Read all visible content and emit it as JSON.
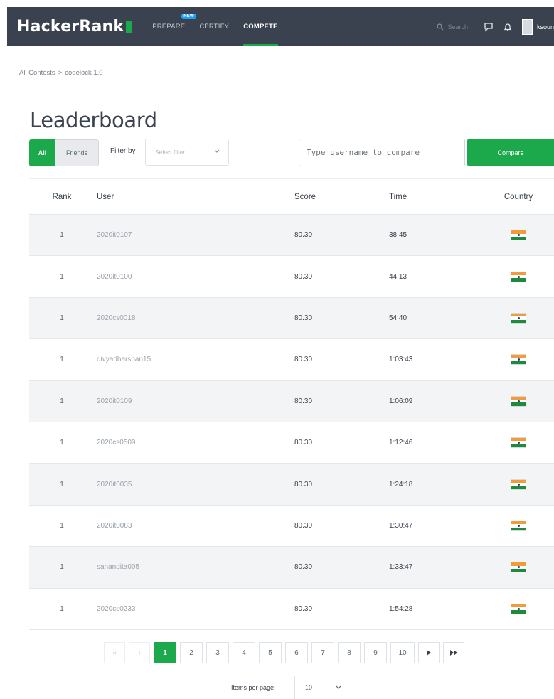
{
  "navbar": {
    "logo": "HackerRank",
    "links": [
      {
        "label": "PREPARE",
        "badge": "NEW"
      },
      {
        "label": "CERTIFY"
      },
      {
        "label": "COMPETE"
      }
    ],
    "search_label": "Search",
    "username": "ksoun_j"
  },
  "breadcrumb": [
    "All Contests",
    ">",
    "codelock 1.0"
  ],
  "page_title": "Leaderboard",
  "toggle": {
    "all": "All",
    "friends": "Friends"
  },
  "filter": {
    "label": "Filter by",
    "placeholder": "Select filter"
  },
  "compare": {
    "placeholder": "Type username to compare",
    "button": "Compare"
  },
  "table": {
    "headers": {
      "rank": "Rank",
      "user": "User",
      "score": "Score",
      "time": "Time",
      "country": "Country"
    },
    "rows": [
      {
        "rank": "1",
        "user": "2020it0107",
        "score": "80.30",
        "time": "38:45",
        "country": "India"
      },
      {
        "rank": "1",
        "user": "2020it0100",
        "score": "80.30",
        "time": "44:13",
        "country": "India"
      },
      {
        "rank": "1",
        "user": "2020cs0018",
        "score": "80.30",
        "time": "54:40",
        "country": "India"
      },
      {
        "rank": "1",
        "user": "divyadharshan15",
        "score": "80.30",
        "time": "1:03:43",
        "country": "India"
      },
      {
        "rank": "1",
        "user": "2020it0109",
        "score": "80.30",
        "time": "1:06:09",
        "country": "India"
      },
      {
        "rank": "1",
        "user": "2020cs0509",
        "score": "80.30",
        "time": "1:12:46",
        "country": "India"
      },
      {
        "rank": "1",
        "user": "2020it0035",
        "score": "80.30",
        "time": "1:24:18",
        "country": "India"
      },
      {
        "rank": "1",
        "user": "2020it0083",
        "score": "80.30",
        "time": "1:30:47",
        "country": "India"
      },
      {
        "rank": "1",
        "user": "sanandita005",
        "score": "80.30",
        "time": "1:33:47",
        "country": "India"
      },
      {
        "rank": "1",
        "user": "2020cs0233",
        "score": "80.30",
        "time": "1:54:28",
        "country": "India"
      }
    ]
  },
  "pagination": {
    "first": "«",
    "prev": "‹",
    "pages": [
      "1",
      "2",
      "3",
      "4",
      "5",
      "6",
      "7",
      "8",
      "9",
      "10"
    ],
    "current_page": "1",
    "next": "▸",
    "last": "⏭",
    "per_page_label": "Items per page:",
    "per_page_value": "10"
  },
  "colors": {
    "accent": "#1ba94c",
    "navbar": "#39424e",
    "badge": "#1da1f2"
  }
}
